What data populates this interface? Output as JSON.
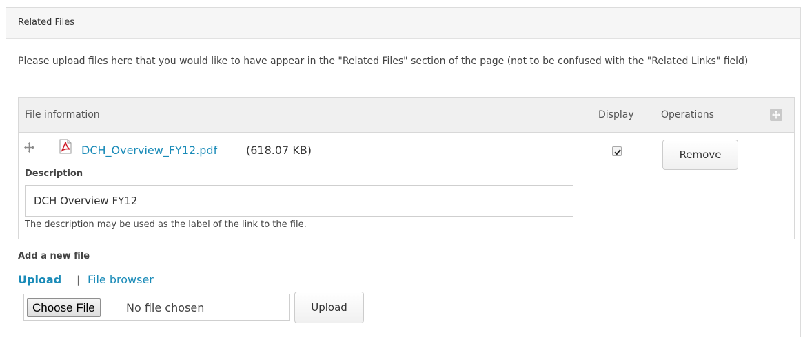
{
  "fieldset": {
    "legend": "Related Files",
    "help_text": "Please upload files here that you would like to have appear in the \"Related Files\" section of the page (not to be confused with the \"Related Links\" field)"
  },
  "table": {
    "headers": {
      "file_info": "File information",
      "display": "Display",
      "operations": "Operations"
    },
    "rows": [
      {
        "file_name": "DCH_Overview_FY12.pdf",
        "file_size": "(618.07 KB)",
        "description_label": "Description",
        "description_value": "DCH Overview FY12",
        "description_help": "The description may be used as the label of the link to the file.",
        "display_checked": true,
        "remove_label": "Remove",
        "icon": "pdf-icon"
      }
    ]
  },
  "add_file": {
    "label": "Add a new file",
    "upload_tab": "Upload",
    "separator": "|",
    "browser_tab": "File browser",
    "choose_label": "Choose File",
    "no_file_text": "No file chosen",
    "upload_button": "Upload"
  },
  "colors": {
    "link": "#1a8bb8",
    "header_bg": "#f0f0f0",
    "legend_bg": "#f6f6f6",
    "pdf_red": "#d0202b"
  }
}
